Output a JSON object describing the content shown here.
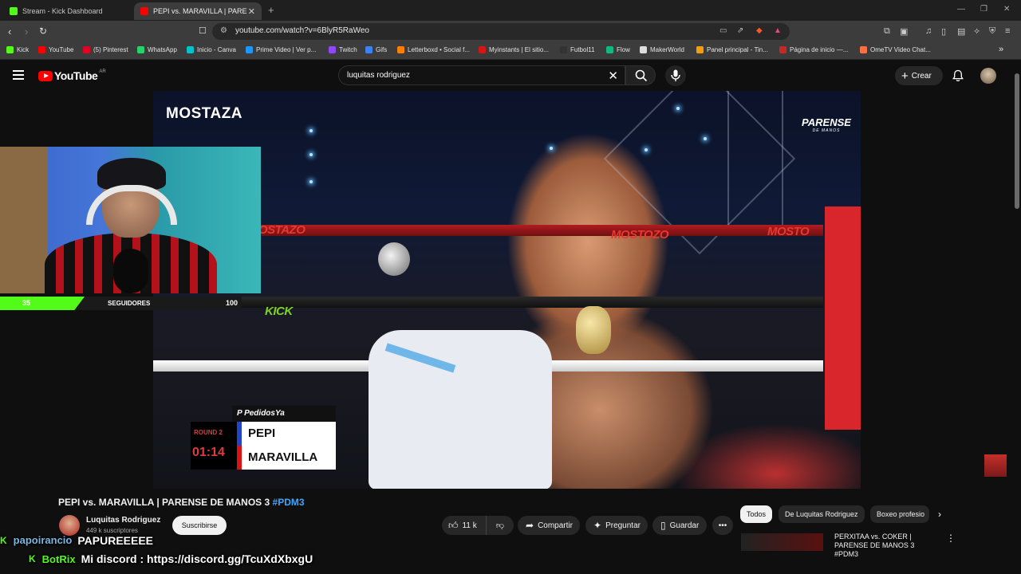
{
  "browser": {
    "tabs": [
      {
        "title": "Stream - Kick Dashboard",
        "active": false,
        "color": "#53fc18"
      },
      {
        "title": "PEPI vs. MARAVILLA | PARENSE",
        "active": true,
        "color": "#ff0000"
      }
    ],
    "url": "youtube.com/watch?v=6BlyR5RaWeo",
    "bookmarks": [
      {
        "label": "Kick",
        "color": "#53fc18"
      },
      {
        "label": "YouTube",
        "color": "#ff0000"
      },
      {
        "label": "(5) Pinterest",
        "color": "#e60023"
      },
      {
        "label": "WhatsApp",
        "color": "#25d366"
      },
      {
        "label": "Inicio - Canva",
        "color": "#00c4cc"
      },
      {
        "label": "Prime Video | Ver p...",
        "color": "#1a98ff"
      },
      {
        "label": "Twitch",
        "color": "#9146ff"
      },
      {
        "label": "Gifs",
        "color": "#3b82f6"
      },
      {
        "label": "Letterboxd • Social f...",
        "color": "#ff8000"
      },
      {
        "label": "Myinstants | El sitio...",
        "color": "#d41616"
      },
      {
        "label": "Futbol11",
        "color": "#333333"
      },
      {
        "label": "Flow",
        "color": "#10b981"
      },
      {
        "label": "MakerWorld",
        "color": "#dddddd"
      },
      {
        "label": "Panel principal - Tin...",
        "color": "#f59e0b"
      },
      {
        "label": "Página de inicio —...",
        "color": "#c62828"
      },
      {
        "label": "OmeTV Video Chat...",
        "color": "#ff7043"
      }
    ],
    "more_bookmarks": "»"
  },
  "youtube": {
    "logo_text": "YouTube",
    "country_code": "AR",
    "search_query": "luquitas rodriguez",
    "create_label": "Crear"
  },
  "video": {
    "brand_left": "MOSTAZA",
    "brand_right": "PARENSE",
    "brand_right_sub": "DE MANOS",
    "ring_texts": [
      "OSTAZO",
      "MOSTOZO",
      "MOSTO",
      "KICK"
    ],
    "scorebug": {
      "sponsor": "PedidosYa",
      "round": "ROUND 2",
      "time": "01:14",
      "fighter1": "PEPI",
      "fighter2": "MARAVILLA"
    }
  },
  "webcam_overlay": {
    "followers_current": "35",
    "followers_label": "SEGUIDORES",
    "followers_goal": "100",
    "progress": 0.35
  },
  "details": {
    "title": "PEPI vs. MARAVILLA | PARENSE DE MANOS 3",
    "hashtag": "#PDM3",
    "channel_name": "Luquitas Rodriguez",
    "subscribers": "449 k suscriptores",
    "subscribe_label": "Suscribirse",
    "likes": "11 k",
    "share_label": "Compartir",
    "ask_label": "Preguntar",
    "save_label": "Guardar"
  },
  "chips": [
    "Todos",
    "De Luquitas Rodriguez",
    "Boxeo profesio"
  ],
  "recommended": {
    "title": "PERXITAA vs. COKER | PARENSE DE MANOS 3 #PDM3"
  },
  "chat": [
    {
      "user": "papoirancio",
      "message": "PAPUREEEEE",
      "color": "#7bb6e0"
    },
    {
      "user": "BotRix",
      "message": "Mi discord : https://discord.gg/TcuXdXbxgU",
      "color": "#53fc18"
    }
  ]
}
